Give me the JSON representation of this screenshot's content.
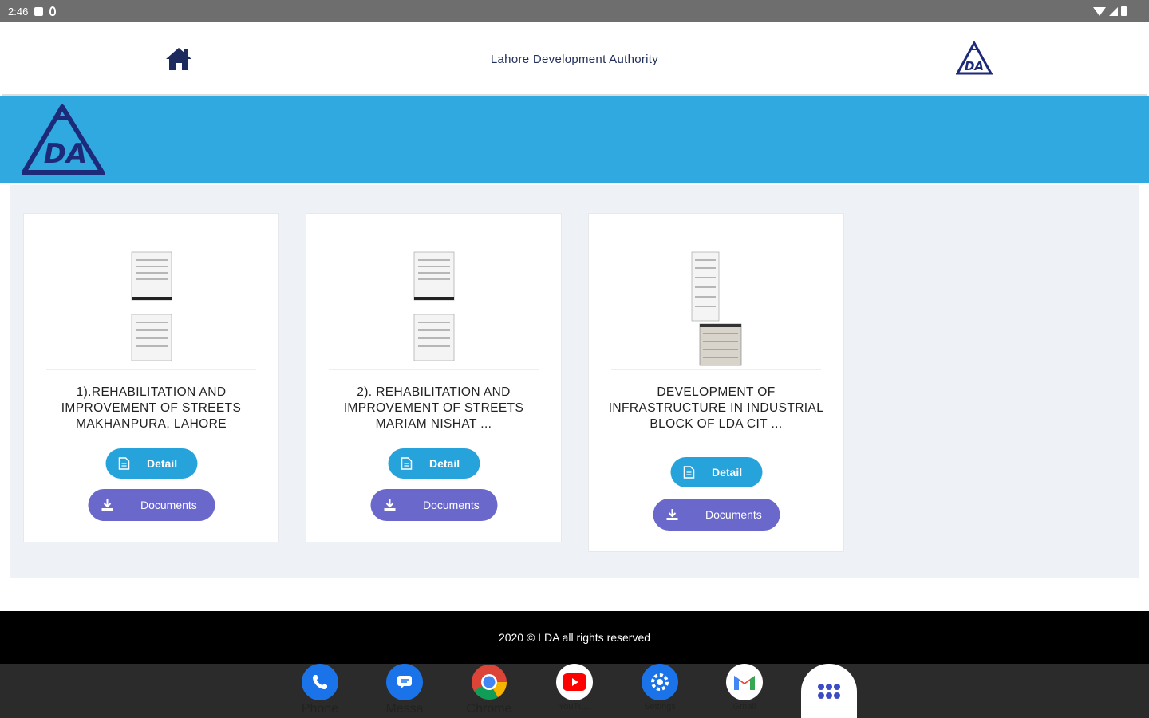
{
  "status_bar": {
    "time": "2:46"
  },
  "header": {
    "title": "Lahore Development Authority"
  },
  "cards": [
    {
      "title": "1).REHABILITATION AND IMPROVEMENT OF STREETS MAKHANPURA, LAHORE",
      "detail_label": "Detail",
      "documents_label": "Documents"
    },
    {
      "title": "2). REHABILITATION AND IMPROVEMENT OF STREETS MARIAM NISHAT ...",
      "detail_label": "Detail",
      "documents_label": "Documents"
    },
    {
      "title": "DEVELOPMENT OF INFRASTRUCTURE IN INDUSTRIAL BLOCK OF LDA CIT ...",
      "detail_label": "Detail",
      "documents_label": "Documents"
    }
  ],
  "footer": {
    "text": "2020 © LDA all rights reserved"
  },
  "dock": {
    "apps": [
      {
        "label": "Phone",
        "icon": "phone-icon",
        "color": "#1a73e8"
      },
      {
        "label": "Messa",
        "icon": "messages-icon",
        "color": "#1a73e8"
      },
      {
        "label": "Chrome",
        "icon": "chrome-icon",
        "color": "#ffffff"
      },
      {
        "label": "YouTu...",
        "icon": "youtube-icon",
        "color": "#ff0000"
      },
      {
        "label": "Settings",
        "icon": "settings-icon",
        "color": "#1a73e8"
      },
      {
        "label": "Gmail",
        "icon": "gmail-icon",
        "color": "#ffffff"
      }
    ]
  },
  "colors": {
    "banner": "#2fa9e0",
    "detail_button": "#27a3dc",
    "documents_button": "#6b68cc",
    "brand_navy": "#1d2a7a"
  }
}
